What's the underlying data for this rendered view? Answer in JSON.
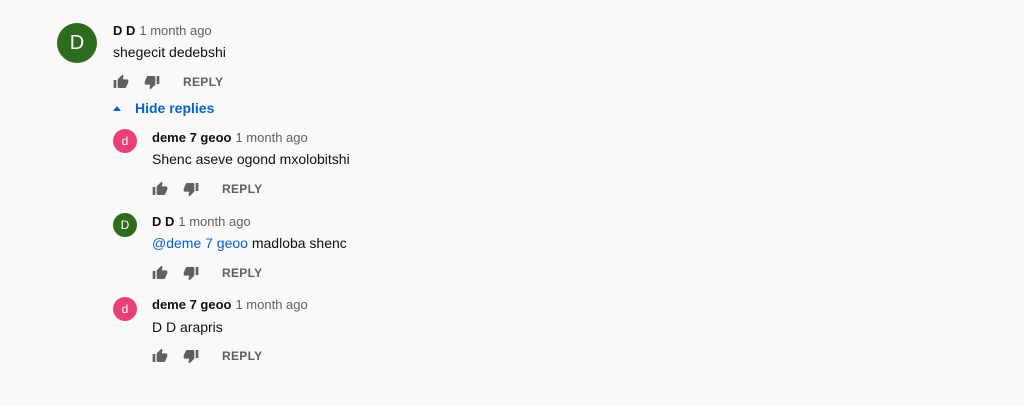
{
  "colors": {
    "green_avatar": "#2e6b1f",
    "pink_avatar": "#e8407a",
    "link": "#065fd4",
    "secondary_text": "#606060"
  },
  "main_comment": {
    "avatar_letter": "D",
    "author": "D D",
    "time": "1 month ago",
    "text": "shegecit dedebshi",
    "reply_label": "REPLY"
  },
  "replies_toggle": {
    "label": "Hide replies"
  },
  "replies": [
    {
      "avatar_letter": "d",
      "author": "deme 7 geoo",
      "time": "1 month ago",
      "mention": "",
      "text": "Shenc aseve ogond mxolobitshi",
      "reply_label": "REPLY"
    },
    {
      "avatar_letter": "D",
      "author": "D D",
      "time": "1 month ago",
      "mention": "@deme 7 geoo",
      "text": "madloba shenc",
      "reply_label": "REPLY"
    },
    {
      "avatar_letter": "d",
      "author": "deme 7 geoo",
      "time": "1 month ago",
      "mention": "",
      "text": "D D arapris",
      "reply_label": "REPLY"
    }
  ]
}
